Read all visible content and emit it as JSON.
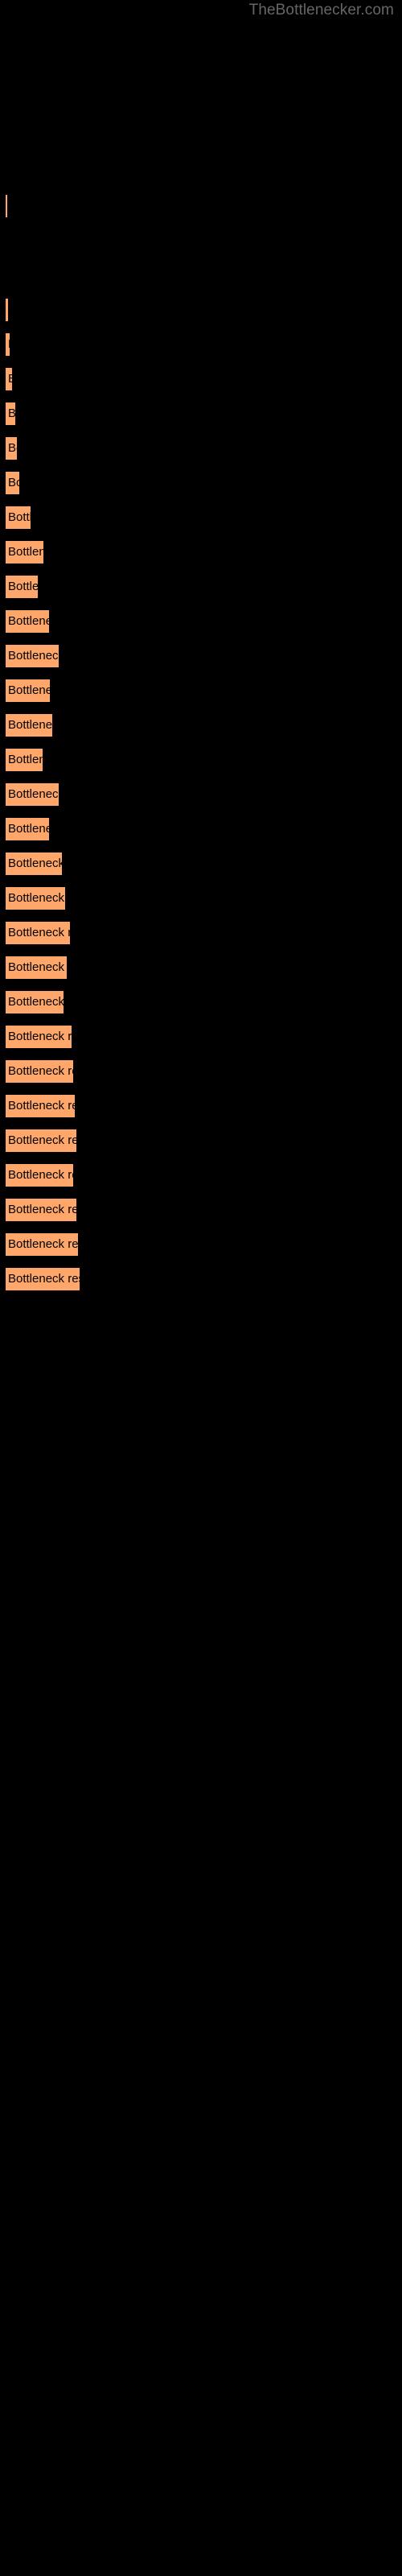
{
  "watermark": {
    "text": "TheBottlenecker.com"
  },
  "style": {
    "background": "#000000",
    "bar_fill": "#FFA76A",
    "bar_stroke": "#000000",
    "label_color": "#000000",
    "watermark_color": "#666666"
  },
  "chart_data": {
    "type": "bar",
    "orientation": "horizontal",
    "title": "",
    "subtitle": "",
    "xlabel": "",
    "ylabel": "",
    "grid": false,
    "legend": null,
    "bar_label_text": "Bottleneck result",
    "xlim": [
      0,
      500
    ],
    "note": "Horizontal bar chart; every bar carries the same data label 'Bottleneck result'. Values are bar pixel widths read off the image (bars start at x=6).",
    "categories": [
      "Bottleneck result",
      "Bottleneck result",
      "Bottleneck result",
      "Bottleneck result",
      "Bottleneck result",
      "Bottleneck result",
      "Bottleneck result",
      "Bottleneck result",
      "Bottleneck result",
      "Bottleneck result",
      "Bottleneck result",
      "Bottleneck result",
      "Bottleneck result",
      "Bottleneck result",
      "Bottleneck result",
      "Bottleneck result",
      "Bottleneck result",
      "Bottleneck result",
      "Bottleneck result",
      "Bottleneck result",
      "Bottleneck result",
      "Bottleneck result",
      "Bottleneck result",
      "Bottleneck result",
      "Bottleneck result",
      "Bottleneck result",
      "Bottleneck result",
      "Bottleneck result",
      "Bottleneck result",
      "Bottleneck result",
      "Bottleneck result",
      "Bottleneck result",
      "Bottleneck result"
    ],
    "values": [
      2,
      4,
      2,
      2,
      5,
      7,
      10,
      14,
      16,
      19,
      23,
      32,
      41,
      45,
      52,
      58,
      64,
      60,
      56,
      52,
      62,
      66,
      70,
      74,
      78,
      80,
      83,
      85,
      86,
      88,
      90,
      92,
      94
    ],
    "bars": [
      {
        "index": 1,
        "label": "Bottleneck result",
        "y": 155,
        "width": 2
      },
      {
        "index": 2,
        "label": "Bottleneck result",
        "y": 241,
        "width": 4
      },
      {
        "index": 3,
        "label": "Bottleneck result",
        "y": 284,
        "width": 2
      },
      {
        "index": 4,
        "label": "Bottleneck result",
        "y": 327,
        "width": 2
      },
      {
        "index": 5,
        "label": "Bottleneck result",
        "y": 370,
        "width": 5
      },
      {
        "index": 6,
        "label": "Bottleneck result",
        "y": 413,
        "width": 7
      },
      {
        "index": 7,
        "label": "Bottleneck result",
        "y": 456,
        "width": 10
      },
      {
        "index": 8,
        "label": "Bottleneck result",
        "y": 499,
        "width": 14
      },
      {
        "index": 9,
        "label": "Bottleneck result",
        "y": 542,
        "width": 16
      },
      {
        "index": 10,
        "label": "Bottleneck result",
        "y": 585,
        "width": 19
      },
      {
        "index": 11,
        "label": "Bottleneck result",
        "y": 628,
        "width": 33
      },
      {
        "index": 12,
        "label": "Bottleneck result",
        "y": 671,
        "width": 49
      },
      {
        "index": 13,
        "label": "Bottleneck result",
        "y": 714,
        "width": 42
      },
      {
        "index": 14,
        "label": "Bottleneck result",
        "y": 757,
        "width": 56
      },
      {
        "index": 15,
        "label": "Bottleneck result",
        "y": 800,
        "width": 68
      },
      {
        "index": 16,
        "label": "Bottleneck result",
        "y": 843,
        "width": 57
      },
      {
        "index": 17,
        "label": "Bottleneck result",
        "y": 886,
        "width": 60
      },
      {
        "index": 18,
        "label": "Bottleneck result",
        "y": 929,
        "width": 48
      },
      {
        "index": 19,
        "label": "Bottleneck result",
        "y": 972,
        "width": 68
      },
      {
        "index": 20,
        "label": "Bottleneck result",
        "y": 1015,
        "width": 56
      },
      {
        "index": 21,
        "label": "Bottleneck result",
        "y": 1058,
        "width": 72
      },
      {
        "index": 22,
        "label": "Bottleneck result",
        "y": 1101,
        "width": 76
      },
      {
        "index": 23,
        "label": "Bottleneck result",
        "y": 1144,
        "width": 82
      },
      {
        "index": 24,
        "label": "Bottleneck result",
        "y": 1187,
        "width": 78
      },
      {
        "index": 25,
        "label": "Bottleneck result",
        "y": 1230,
        "width": 74
      },
      {
        "index": 26,
        "label": "Bottleneck result",
        "y": 1273,
        "width": 84
      },
      {
        "index": 27,
        "label": "Bottleneck result",
        "y": 1316,
        "width": 86
      },
      {
        "index": 28,
        "label": "Bottleneck result",
        "y": 1359,
        "width": 88
      },
      {
        "index": 29,
        "label": "Bottleneck result",
        "y": 1402,
        "width": 90
      },
      {
        "index": 30,
        "label": "Bottleneck result",
        "y": 1445,
        "width": 86
      },
      {
        "index": 31,
        "label": "Bottleneck result",
        "y": 1488,
        "width": 90
      },
      {
        "index": 32,
        "label": "Bottleneck result",
        "y": 1531,
        "width": 92
      },
      {
        "index": 33,
        "label": "Bottleneck result",
        "y": 1574,
        "width": 94
      }
    ]
  }
}
